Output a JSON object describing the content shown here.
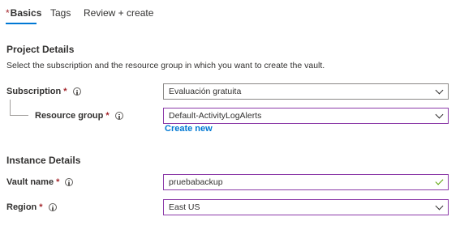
{
  "tabs": [
    {
      "label": "Basics",
      "required": "*",
      "active": true
    },
    {
      "label": "Tags",
      "active": false
    },
    {
      "label": "Review + create",
      "active": false
    }
  ],
  "project_details": {
    "title": "Project Details",
    "description": "Select the subscription and the resource group in which you want to create the vault."
  },
  "subscription": {
    "label": "Subscription",
    "required": "*",
    "value": "Evaluación gratuita"
  },
  "resource_group": {
    "label": "Resource group",
    "required": "*",
    "value": "Default-ActivityLogAlerts",
    "create_new": "Create new"
  },
  "instance_details": {
    "title": "Instance Details"
  },
  "vault_name": {
    "label": "Vault name",
    "required": "*",
    "value": "pruebabackup"
  },
  "region": {
    "label": "Region",
    "required": "*",
    "value": "East US"
  },
  "colors": {
    "accent": "#0078d4",
    "required": "#a4262c",
    "focus_border": "#8b3aa8",
    "valid_check": "#57a300"
  }
}
